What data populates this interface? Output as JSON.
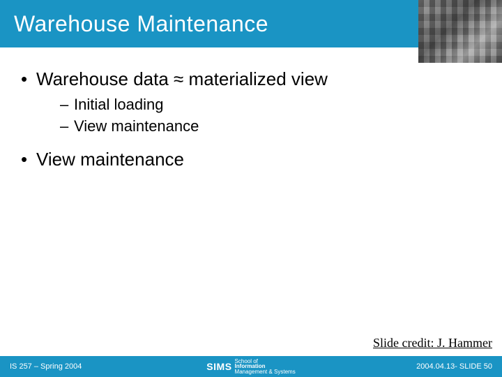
{
  "title": "Warehouse Maintenance",
  "bullets": {
    "b1": "Warehouse data ≈ materialized view",
    "b1_sub1": "Initial loading",
    "b1_sub2": "View maintenance",
    "b2": "View maintenance"
  },
  "credit": "Slide credit: J. Hammer",
  "footer": {
    "left": "IS 257 – Spring 2004",
    "logo_main": "SIMS",
    "logo_l1": "School of",
    "logo_l2": "Information",
    "logo_l3": "Management & Systems",
    "right": "2004.04.13- SLIDE 50"
  }
}
